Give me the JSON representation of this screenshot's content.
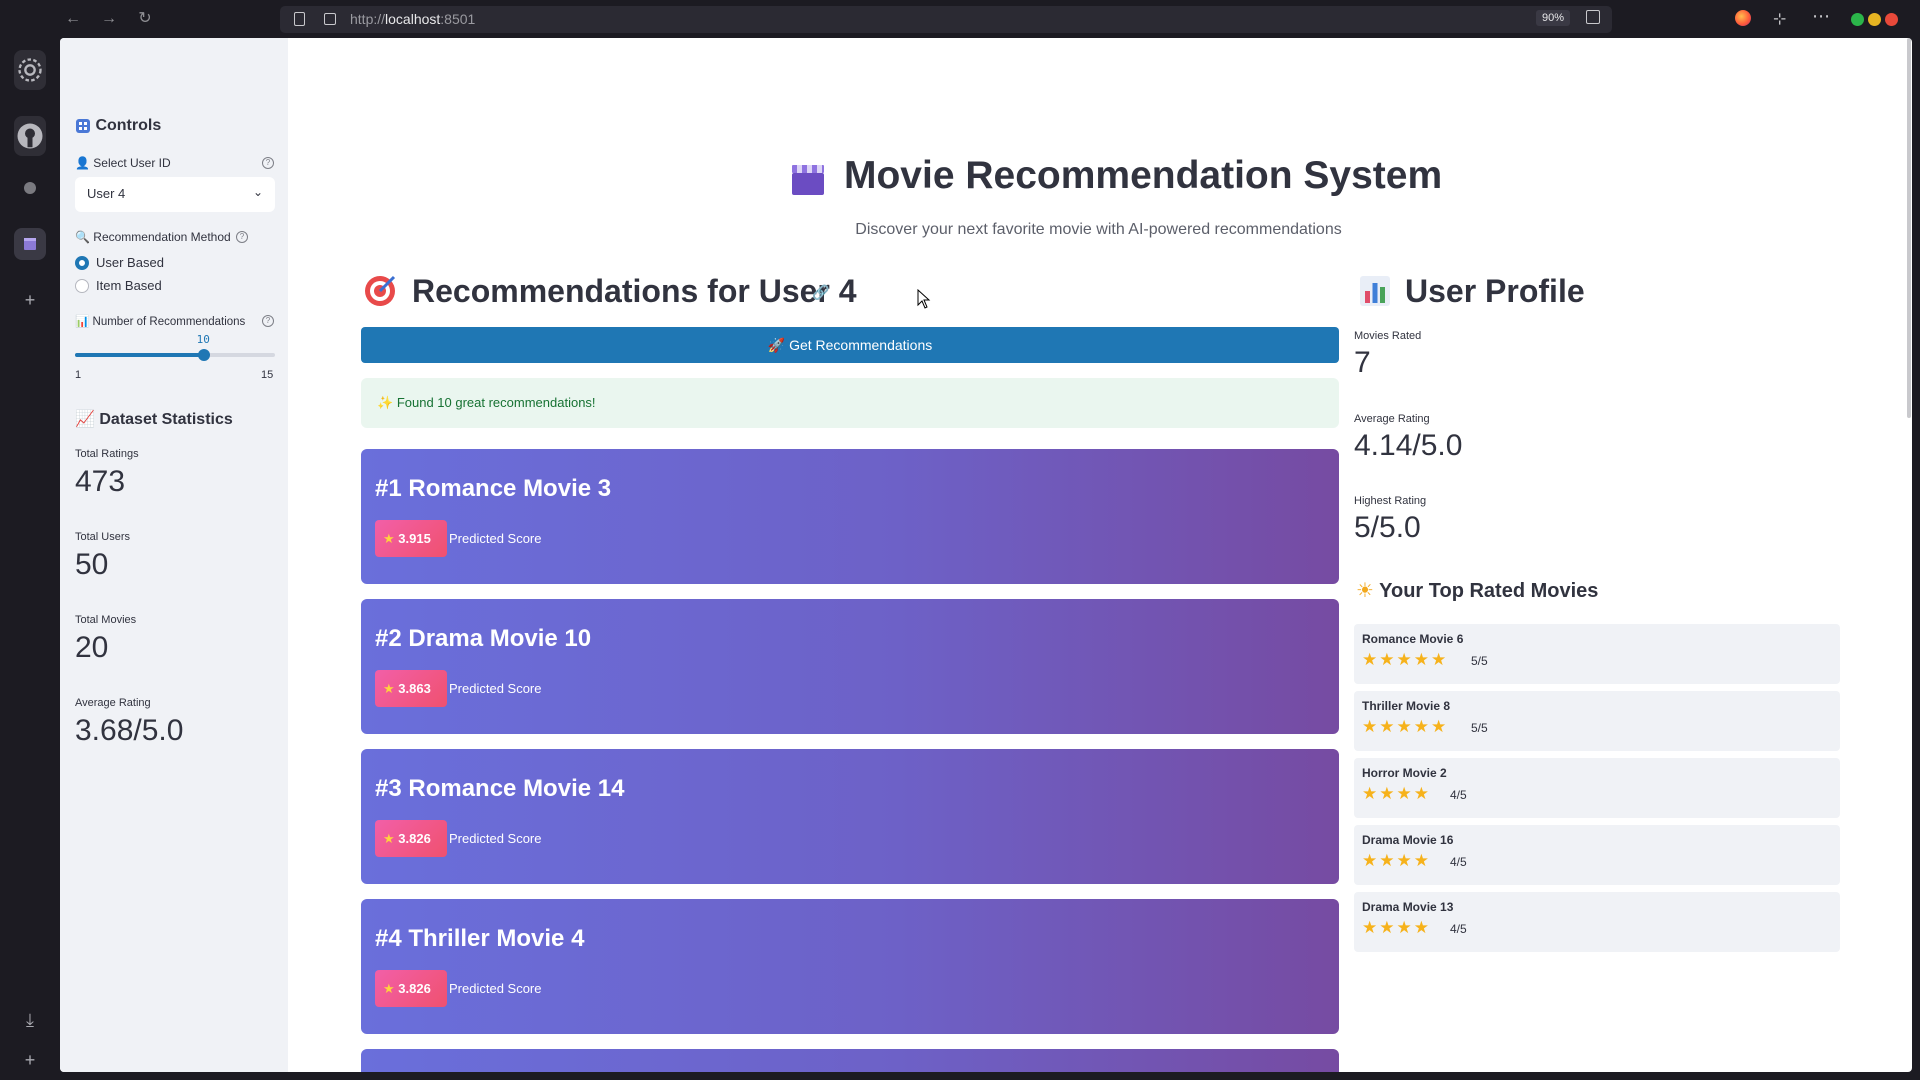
{
  "browser": {
    "url_prefix": "http://",
    "url_host": "localhost",
    "url_port": ":8501",
    "zoom": "90%"
  },
  "sidebar": {
    "controls_title": "Controls",
    "select_user_label": "Select User ID",
    "select_user_value": "User 4",
    "method_label": "Recommendation Method",
    "method_options": [
      "User Based",
      "Item Based"
    ],
    "method_selected": "User Based",
    "num_label": "Number of Recommendations",
    "num_value": "10",
    "num_min": "1",
    "num_max": "15",
    "num_fraction": 0.643,
    "dataset_title": "Dataset Statistics",
    "stats": [
      {
        "label": "Total Ratings",
        "value": "473"
      },
      {
        "label": "Total Users",
        "value": "50"
      },
      {
        "label": "Total Movies",
        "value": "20"
      },
      {
        "label": "Average Rating",
        "value": "3.68/5.0"
      }
    ]
  },
  "main": {
    "title": "Movie Recommendation System",
    "subtitle": "Discover your next favorite movie with AI-powered recommendations",
    "recs_title": "Recommendations for User 4",
    "get_button": "Get Recommendations",
    "success_msg": "Found 10 great recommendations!",
    "predicted_label": "Predicted Score",
    "recommendations": [
      {
        "title": "#1 Romance Movie 3",
        "score": "3.915"
      },
      {
        "title": "#2 Drama Movie 10",
        "score": "3.863"
      },
      {
        "title": "#3 Romance Movie 14",
        "score": "3.826"
      },
      {
        "title": "#4 Thriller Movie 4",
        "score": "3.826"
      }
    ]
  },
  "profile": {
    "title": "User Profile",
    "movies_rated_label": "Movies Rated",
    "movies_rated": "7",
    "avg_label": "Average Rating",
    "avg_value": "4.14/5.0",
    "highest_label": "Highest Rating",
    "highest_value": "5/5.0",
    "top_title": "Your Top Rated Movies",
    "top_movies": [
      {
        "name": "Romance Movie 6",
        "stars": 5,
        "score": "5/5"
      },
      {
        "name": "Thriller Movie 8",
        "stars": 5,
        "score": "5/5"
      },
      {
        "name": "Horror Movie 2",
        "stars": 4,
        "score": "4/5"
      },
      {
        "name": "Drama Movie 16",
        "stars": 4,
        "score": "4/5"
      },
      {
        "name": "Drama Movie 13",
        "stars": 4,
        "score": "4/5"
      }
    ]
  },
  "colors": {
    "primary": "#1f77b4",
    "card_gradient_start": "#667eea",
    "card_gradient_end": "#764ba2",
    "badge": "#f0516f",
    "star": "#f6b21b"
  }
}
